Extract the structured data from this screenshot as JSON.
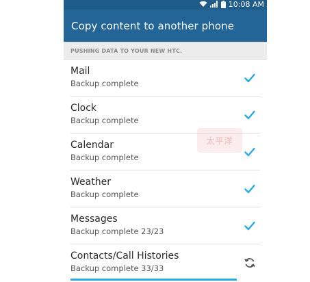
{
  "status_bar": {
    "time": "10:08",
    "ampm": "AM",
    "icons": [
      "wifi-icon",
      "signal-icon",
      "battery-icon"
    ]
  },
  "app_bar": {
    "title": "Copy content to another phone",
    "background": "#236596"
  },
  "section": {
    "header": "PUSHING DATA TO YOUR NEW HTC."
  },
  "items": [
    {
      "title": "Mail",
      "status": "Backup complete",
      "state": "done"
    },
    {
      "title": "Clock",
      "status": "Backup complete",
      "state": "done"
    },
    {
      "title": "Calendar",
      "status": "Backup complete",
      "state": "done"
    },
    {
      "title": "Weather",
      "status": "Backup complete",
      "state": "done"
    },
    {
      "title": "Messages",
      "status": "Backup complete 23/23",
      "state": "done"
    },
    {
      "title": "Contacts/Call Histories",
      "status": "Backup complete 33/33",
      "state": "syncing",
      "progress": 1.0
    }
  ],
  "colors": {
    "check": "#2aa9e0",
    "sync_icon": "#555555"
  },
  "watermark": "太平洋"
}
